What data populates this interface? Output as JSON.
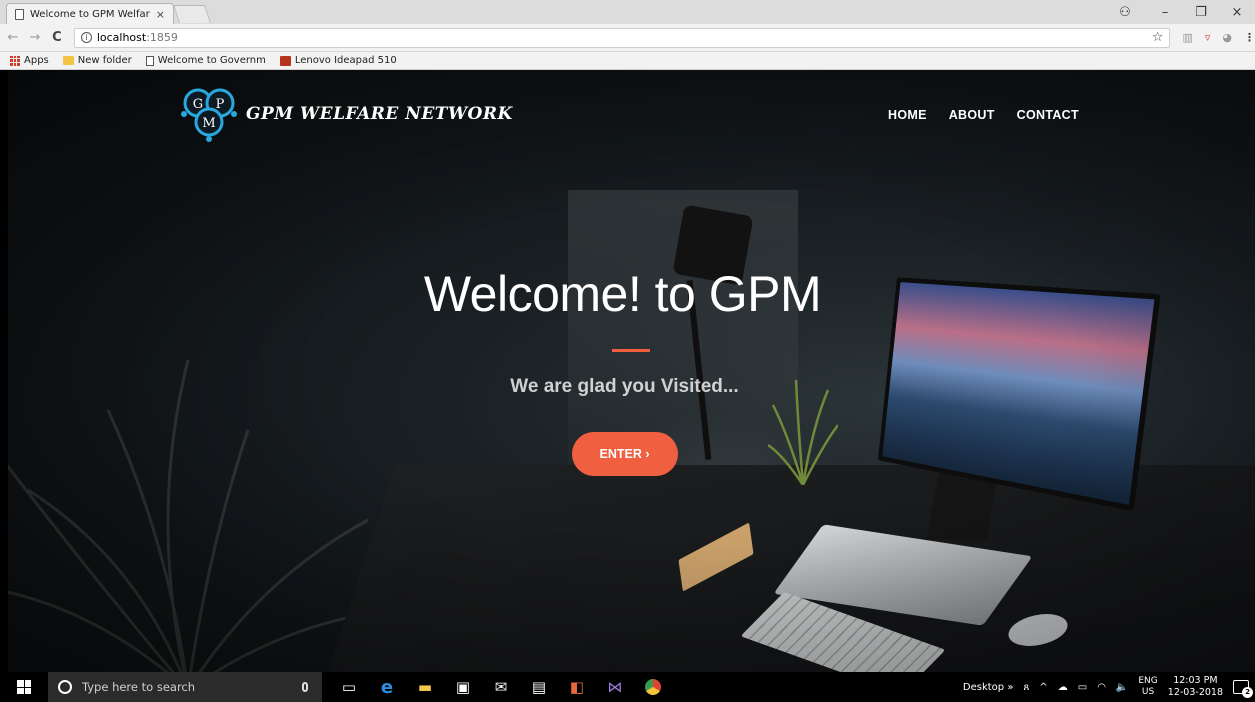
{
  "browser": {
    "tab_title": "Welcome to GPM Welfar",
    "tab_close": "×",
    "url_host": "localhost",
    "url_port": ":1859",
    "window_controls": {
      "minimize": "–",
      "maximize": "❐",
      "close": "×"
    },
    "bookmarks": [
      {
        "label": "Apps",
        "icon": "apps-grid-icon"
      },
      {
        "label": "New folder",
        "icon": "folder-icon"
      },
      {
        "label": "Welcome to Governm",
        "icon": "page-icon"
      },
      {
        "label": "Lenovo Ideapad 510",
        "icon": "lenovo-icon"
      }
    ]
  },
  "site": {
    "brand": "GPM WELFARE NETWORK",
    "logo_letters": [
      "G",
      "P",
      "M"
    ],
    "nav": [
      "HOME",
      "ABOUT",
      "CONTACT"
    ],
    "hero_title": "Welcome! to GPM",
    "hero_subtitle": "We are glad you Visited...",
    "enter_button": "ENTER ›",
    "accent_color": "#f05f40"
  },
  "taskbar": {
    "search_placeholder": "Type here to search",
    "desktop_label": "Desktop",
    "desktop_chevron": "»",
    "language": "ENG",
    "region": "US",
    "time": "12:03 PM",
    "date": "12-03-2018",
    "notifications": "2"
  }
}
